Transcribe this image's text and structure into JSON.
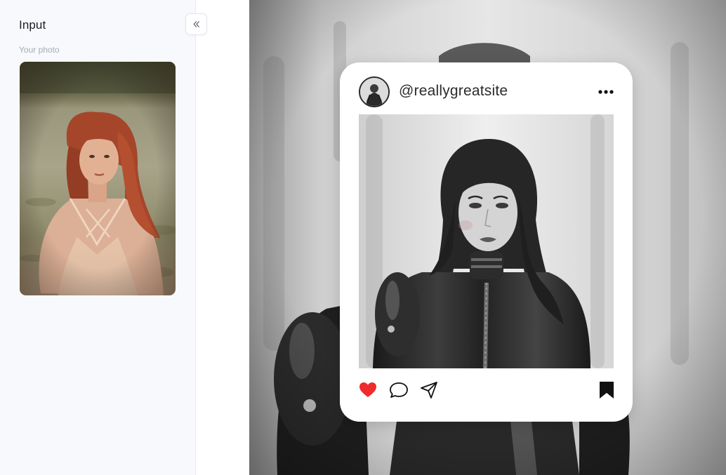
{
  "sidebar": {
    "title": "Input",
    "section_label": "Your photo",
    "collapse_icon": "double-chevron-left-icon"
  },
  "post": {
    "username": "@reallygreatsite",
    "icons": {
      "more": "more-dots-icon",
      "like": "heart-icon",
      "comment": "comment-icon",
      "share": "send-icon",
      "save": "bookmark-icon"
    },
    "like_color": "#ee2c2c"
  },
  "colors": {
    "sidebar_bg": "#f8f9fc",
    "card_bg": "#ffffff",
    "text_dark": "#1d1f24",
    "muted": "#a7abb4"
  }
}
